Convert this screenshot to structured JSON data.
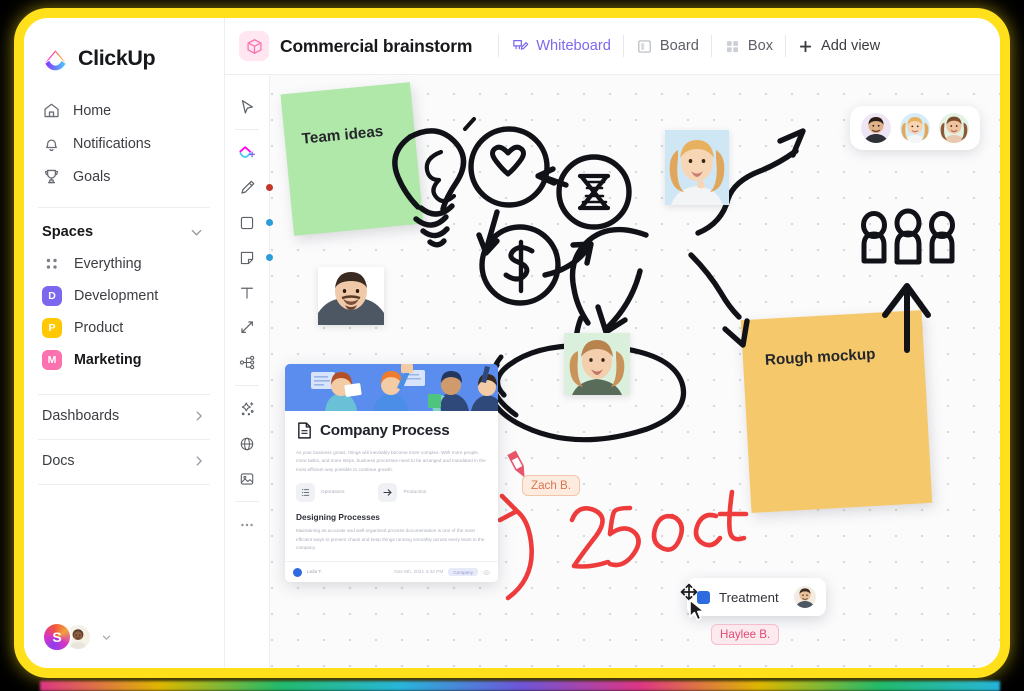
{
  "window": {
    "frame_color": "#FFE01B",
    "background": "#000000"
  },
  "sidebar": {
    "brand": "ClickUp",
    "nav": [
      {
        "label": "Home",
        "icon": "home-icon"
      },
      {
        "label": "Notifications",
        "icon": "bell-icon"
      },
      {
        "label": "Goals",
        "icon": "trophy-icon"
      }
    ],
    "spaces_title": "Spaces",
    "spaces": [
      {
        "label": "Everything",
        "icon": "grid-dots-icon",
        "badge": "",
        "color": "",
        "active": false
      },
      {
        "label": "Development",
        "icon": "space-badge",
        "badge": "D",
        "color": "#7B68EE",
        "active": false
      },
      {
        "label": "Product",
        "icon": "space-badge",
        "badge": "P",
        "color": "#FFC800",
        "active": false
      },
      {
        "label": "Marketing",
        "icon": "space-badge",
        "badge": "M",
        "color": "#FD71AF",
        "active": true
      }
    ],
    "footer_links": [
      {
        "label": "Dashboards"
      },
      {
        "label": "Docs"
      }
    ],
    "user": {
      "initial": "S"
    }
  },
  "topbar": {
    "doc_icon": "box-3d-icon",
    "title": "Commercial brainstorm",
    "views": [
      {
        "label": "Whiteboard",
        "icon": "whiteboard-icon",
        "active": true
      },
      {
        "label": "Board",
        "icon": "board-icon",
        "active": false
      },
      {
        "label": "Box",
        "icon": "box-grid-icon",
        "active": false
      }
    ],
    "add_view": "Add view"
  },
  "toolbar": {
    "items": [
      {
        "name": "select-tool",
        "icon": "cursor-icon",
        "dot": ""
      },
      {
        "name": "shapes-tool",
        "icon": "shapes-plus-icon",
        "dot": ""
      },
      {
        "name": "pen-tool",
        "icon": "pen-icon",
        "dot": "#C0392B"
      },
      {
        "name": "rectangle-tool",
        "icon": "square-icon",
        "dot": "#2D9CDB"
      },
      {
        "name": "sticky-note-tool",
        "icon": "sticky-note-icon",
        "dot": "#2D9CDB"
      },
      {
        "name": "text-tool",
        "icon": "text-t-icon",
        "dot": ""
      },
      {
        "name": "connector-tool",
        "icon": "connector-arrow-icon",
        "dot": ""
      },
      {
        "name": "mindmap-tool",
        "icon": "mindmap-icon",
        "dot": ""
      },
      {
        "name": "ai-tool",
        "icon": "sparkle-wand-icon",
        "dot": ""
      },
      {
        "name": "embed-tool",
        "icon": "globe-icon",
        "dot": ""
      },
      {
        "name": "image-tool",
        "icon": "image-icon",
        "dot": ""
      },
      {
        "name": "more-tool",
        "icon": "ellipsis-icon",
        "dot": ""
      }
    ]
  },
  "canvas": {
    "sticky_notes": [
      {
        "text": "Team ideas",
        "color": "#AFE8A8"
      },
      {
        "text": "Rough mockup",
        "color": "#F5C96B"
      }
    ],
    "handwriting": {
      "date_note": "25 oct",
      "color": "#EE3B3B"
    },
    "doc_card": {
      "title": "Company Process",
      "paragraph": "As your business grows, things will inevitably become more complex. With more people, more tasks, and more steps, business processes need to be arranged and mandated in the most efficient way possible to continue growth.",
      "chips": [
        {
          "label": "Operations",
          "icon": "list-icon"
        },
        {
          "label": "Production",
          "icon": "arrow-right-icon"
        }
      ],
      "subheading": "Designing Processes",
      "subparagraph": "Maintaining as accurate and well-organized process documentation is one of the most efficient ways to prevent chaos and keep things running smoothly across every team in the company.",
      "author": "Leila T.",
      "timestamp": "Nov 8th, 2021 4:42 PM",
      "tag": "Company"
    },
    "task_card": {
      "label": "Treatment",
      "square_color": "#2D6BE0",
      "cursor": "move-cursor"
    },
    "cursors": [
      {
        "name": "Zach B.",
        "color": "#E8825A",
        "bg": "#FDEBDF",
        "tool": "pen-cursor"
      },
      {
        "name": "Haylee B.",
        "color": "#E8557A",
        "bg": "#FDEAEF",
        "tool": "arrow-cursor"
      }
    ],
    "collaborators": [
      {
        "status_color": "#E8344E"
      },
      {
        "status_color": "#F02FA2"
      },
      {
        "status_color": "#F5A623"
      }
    ],
    "drawings": [
      {
        "name": "heart-circle-sketch"
      },
      {
        "name": "hourglass-circle-sketch"
      },
      {
        "name": "dollar-circle-sketch"
      },
      {
        "name": "lightbulb-sketch"
      },
      {
        "name": "people-group-sketch"
      },
      {
        "name": "up-arrow-sketch"
      },
      {
        "name": "ellipse-highlight-sketch"
      }
    ]
  }
}
